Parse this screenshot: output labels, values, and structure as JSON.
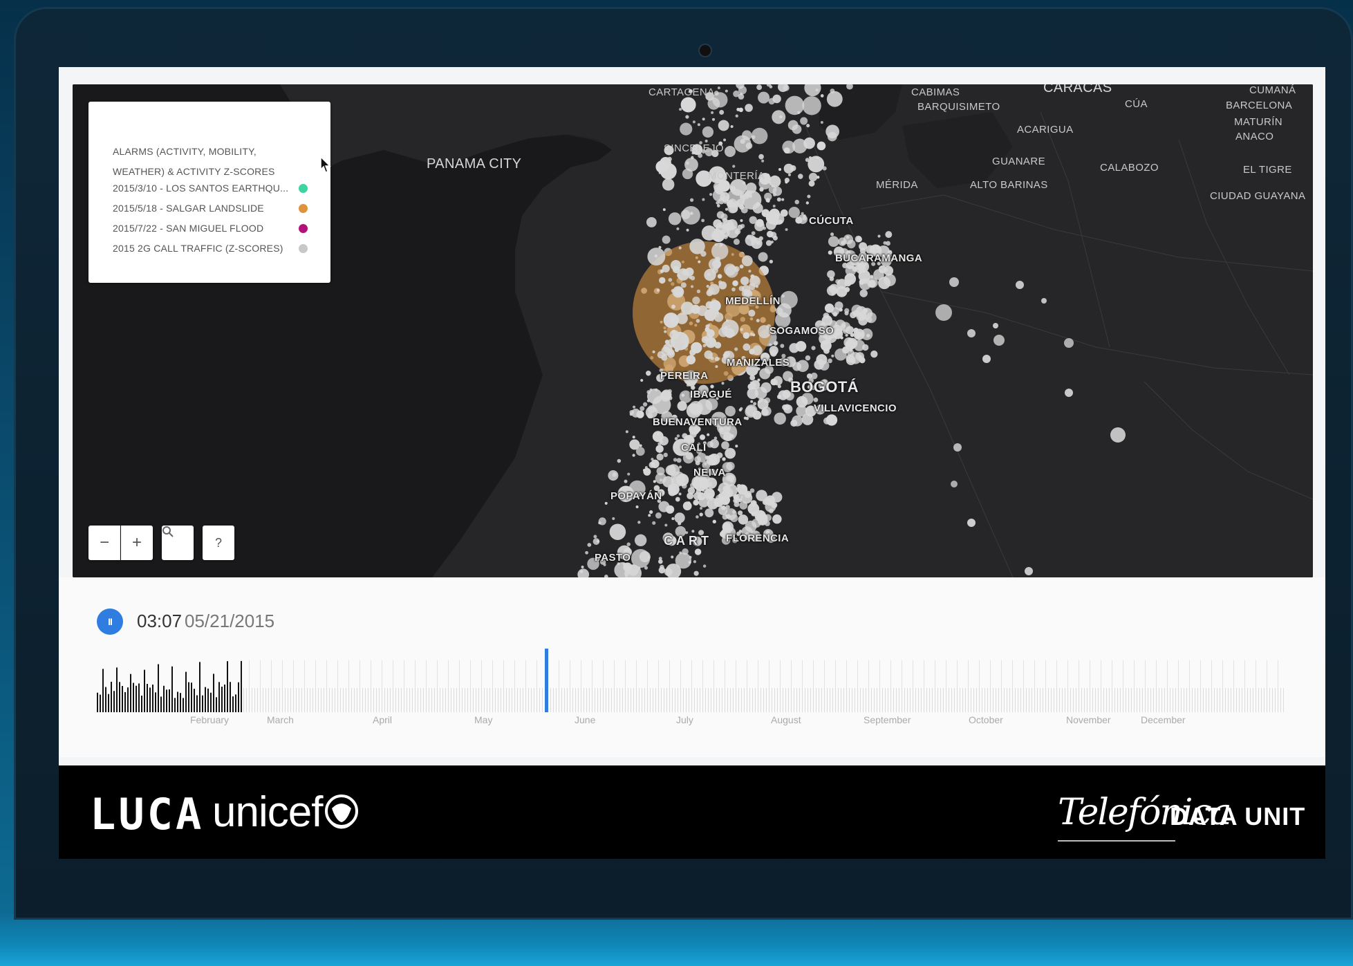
{
  "legend": {
    "title": "ALARMS (ACTIVITY, MOBILITY, WEATHER) & ACTIVITY Z-SCORES",
    "items": [
      {
        "label": "2015/3/10 - LOS SANTOS EARTHQU...",
        "color": "#3ed3a3"
      },
      {
        "label": "2015/5/18 - SALGAR LANDSLIDE",
        "color": "#e0923a"
      },
      {
        "label": "2015/7/22 - SAN MIGUEL FLOOD",
        "color": "#b0127a"
      },
      {
        "label": "2015 2G CALL TRAFFIC (Z-SCORES)",
        "color": "#c8c8c8"
      }
    ]
  },
  "map_controls": {
    "zoom_out": "−",
    "zoom_in": "+",
    "search": "🔍",
    "help": "?"
  },
  "cities": {
    "cartagena": "CARTAGENA",
    "cabimas": "CABIMAS",
    "caracas": "CARACAS",
    "cumana": "CUMANÁ",
    "barquisimeto": "BARQUISIMETO",
    "cua": "CÚA",
    "barcelona": "BARCELONA",
    "maturin": "MATURÍN",
    "anaco": "ANACO",
    "acarigua": "ACARIGUA",
    "panama_city": "PANAMA CITY",
    "sincelejo": "SINCELEJO",
    "guanare": "GUANARE",
    "calabozo": "CALABOZO",
    "el_tigre": "EL TIGRE",
    "monteria": "MONTERÍA",
    "merida": "MÉRIDA",
    "alto_barinas": "ALTO BARINAS",
    "ciudad_guayana": "CIUDAD GUAYANA",
    "cucuta": "CÚCUTA",
    "bucaramanga": "BUCARAMANGA",
    "medellin": "MEDELLÍN",
    "sogamoso": "SOGAMOSO",
    "manizales": "MANIZALES",
    "pereira": "PEREIRA",
    "bogota": "BOGOTÁ",
    "ibague": "IBAGUÉ",
    "villavicencio": "VILLAVICENCIO",
    "buenaventura": "BUENAVENTURA",
    "cali": "CALI",
    "neiva": "NEIVA",
    "popayan": "POPAYÁN",
    "carto": "CART",
    "florencia": "FLORENCIA",
    "pasto": "PASTO"
  },
  "timeline": {
    "time": "03:07",
    "date": "05/21/2015",
    "months": [
      "February",
      "March",
      "April",
      "May",
      "June",
      "July",
      "August",
      "September",
      "October",
      "November",
      "December"
    ]
  },
  "footer": {
    "luca": "LUCA",
    "unicef": "unicef",
    "telefonica": "Telefónica",
    "data_unit": "DATA UNIT"
  }
}
